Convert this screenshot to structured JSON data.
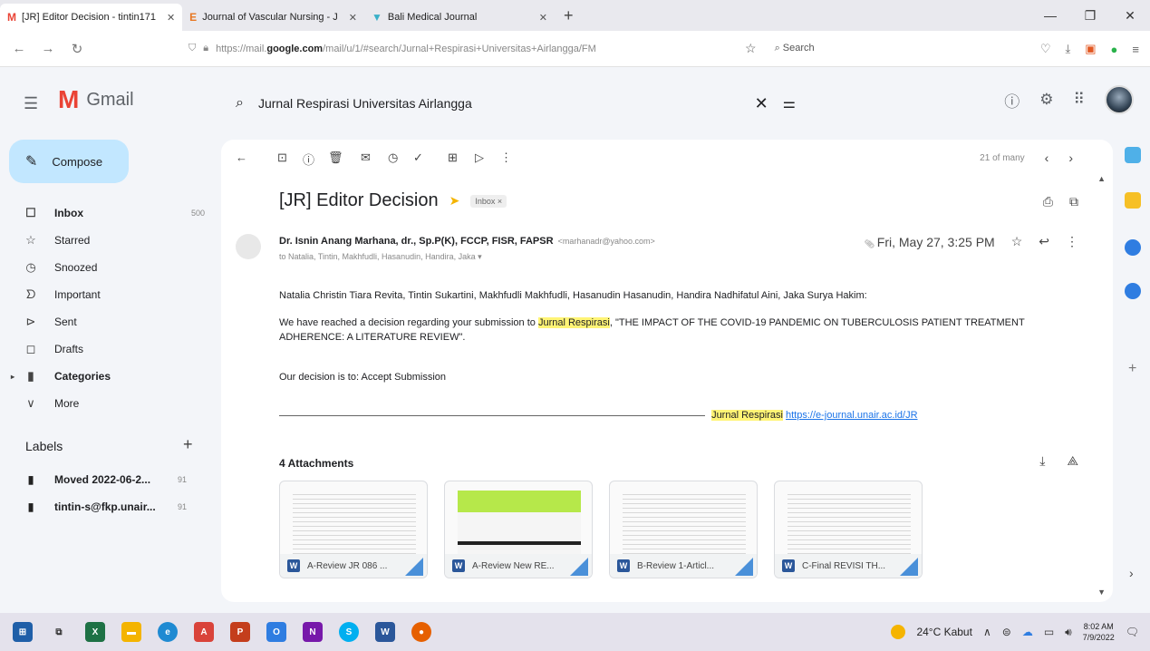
{
  "browser": {
    "tabs": [
      {
        "favicon": "M",
        "title": "[JR] Editor Decision - tintin171",
        "active": true
      },
      {
        "favicon": "E",
        "title": "Journal of Vascular Nursing - J",
        "active": false
      },
      {
        "favicon": "▼",
        "title": "Bali Medical Journal",
        "active": false
      }
    ],
    "new_tab": "+",
    "url_pre": "https://mail.",
    "url_bold": "google.com",
    "url_post": "/mail/u/1/#search/Jurnal+Respirasi+Universitas+Airlangga/FM",
    "search_placeholder": "Search"
  },
  "gmail": {
    "logo_letter": "M",
    "logo_text": "Gmail",
    "search_query": "Jurnal Respirasi Universitas Airlangga"
  },
  "sidebar": {
    "compose": "Compose",
    "items": [
      {
        "icon": "inbox-icon",
        "glyph": "☐",
        "label": "Inbox",
        "count": "500",
        "bold": true
      },
      {
        "icon": "star-icon",
        "glyph": "☆",
        "label": "Starred",
        "count": "",
        "bold": false
      },
      {
        "icon": "clock-icon",
        "glyph": "◷",
        "label": "Snoozed",
        "count": "",
        "bold": false
      },
      {
        "icon": "important-icon",
        "glyph": "ᗤ",
        "label": "Important",
        "count": "",
        "bold": false
      },
      {
        "icon": "send-icon",
        "glyph": "⊳",
        "label": "Sent",
        "count": "",
        "bold": false
      },
      {
        "icon": "draft-icon",
        "glyph": "◻",
        "label": "Drafts",
        "count": "",
        "bold": false
      },
      {
        "icon": "label-icon",
        "glyph": "▮",
        "label": "Categories",
        "count": "",
        "bold": true
      },
      {
        "icon": "chevron-down-icon",
        "glyph": "∨",
        "label": "More",
        "count": "",
        "bold": false
      }
    ],
    "labels_heading": "Labels",
    "labels": [
      {
        "label": "Moved 2022-06-2...",
        "count": "91"
      },
      {
        "label": "tintin-s@fkp.unair...",
        "count": "91"
      }
    ]
  },
  "toolbar": {
    "pager_text": "21 of many"
  },
  "email": {
    "subject": "[JR] Editor Decision",
    "inbox_chip": "Inbox ×",
    "sender_name": "Dr. Isnin Anang Marhana, dr., Sp.P(K), FCCP, FISR, FAPSR",
    "sender_email": "<marhanadr@yahoo.com>",
    "to_line": "to Natalia, Tintin, Makhfudli, Hasanudin, Handira, Jaka ▾",
    "date": "Fri, May 27, 3:25 PM",
    "greeting": "Natalia Christin Tiara Revita, Tintin Sukartini, Makhfudli Makhfudli, Hasanudin Hasanudin, Handira Nadhifatul Aini, Jaka Surya Hakim:",
    "p1_a": "We have reached a decision regarding your submission to ",
    "p1_hl": "Jurnal Respirasi",
    "p1_b": ", \"THE IMPACT OF THE COVID-19 PANDEMIC ON TUBERCULOSIS PATIENT TREATMENT ADHERENCE: A LITERATURE REVIEW\".",
    "p2": "Our decision is to: Accept Submission",
    "sig_name": "Jurnal Respirasi",
    "sig_link": "https://e-journal.unair.ac.id/JR"
  },
  "attachments": {
    "title": "4 Attachments",
    "files": [
      {
        "name": "A-Review JR 086 ..."
      },
      {
        "name": "A-Review New RE..."
      },
      {
        "name": "B-Review 1-Articl..."
      },
      {
        "name": "C-Final REVISI TH..."
      }
    ]
  },
  "taskbar": {
    "weather": "24°C Kabut",
    "time": "8:02 AM",
    "date": "7/9/2022"
  },
  "colors": {
    "compose_bg": "#c2e7ff",
    "highlight": "#fff475",
    "link": "#1a73e8",
    "gmail_red": "#ea4335",
    "word_blue": "#2b579a"
  }
}
